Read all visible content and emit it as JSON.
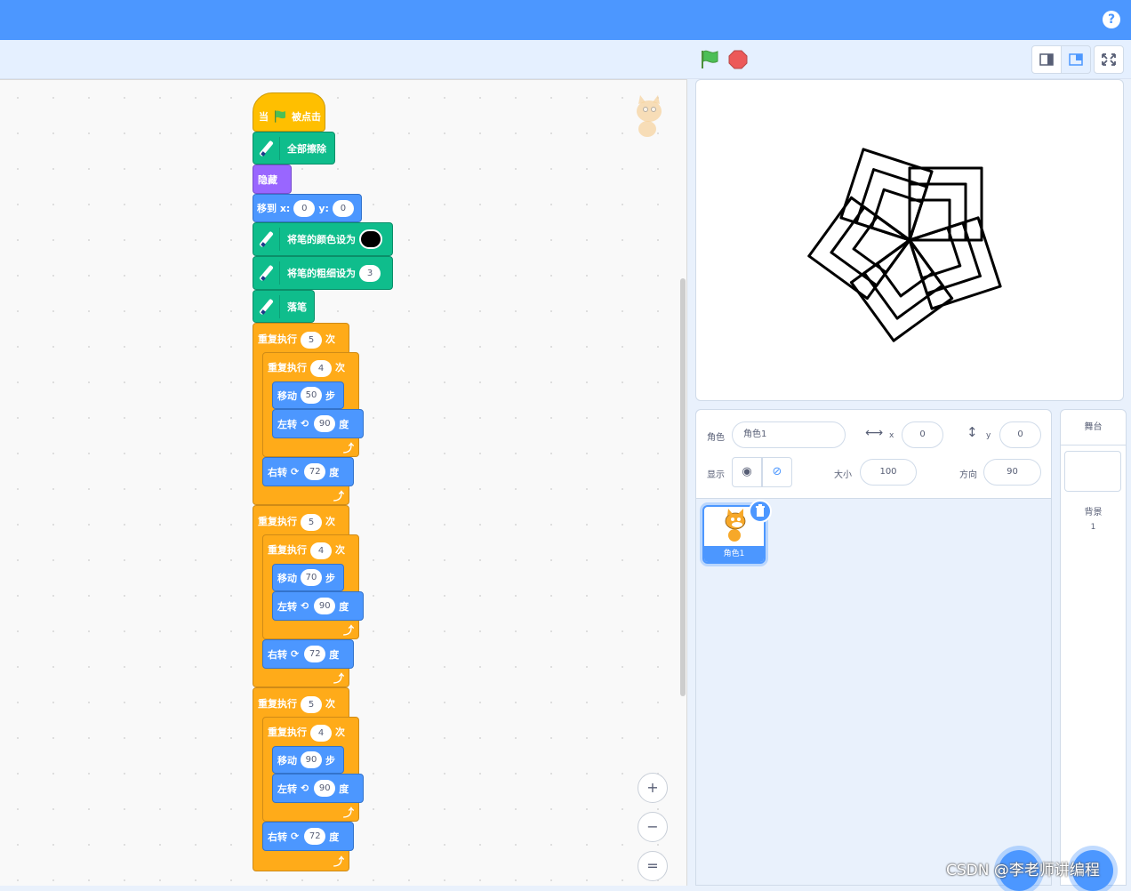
{
  "header": {
    "help_icon": "help-icon",
    "help_label": "?"
  },
  "controls": {
    "flag_icon": "green-flag-icon",
    "stop_icon": "stop-icon"
  },
  "script": {
    "hat": {
      "prefix": "当",
      "suffix": "被点击"
    },
    "clear": "全部擦除",
    "hide": "隐藏",
    "goto": {
      "label": "移到 x:",
      "x": "0",
      "y_label": "y:",
      "y": "0"
    },
    "pen_color": {
      "label": "将笔的颜色设为",
      "color": "#000000"
    },
    "pen_size": {
      "label": "将笔的粗细设为",
      "value": "3"
    },
    "pen_down": "落笔",
    "loops": [
      {
        "repeat_label": "重复执行",
        "times": "5",
        "times_suffix": "次",
        "inner_repeat": "重复执行",
        "inner_times": "4",
        "inner_suffix": "次",
        "move_label": "移动",
        "steps": "50",
        "steps_suffix": "步",
        "turn_left_label": "左转",
        "left_deg": "90",
        "deg_suffix": "度",
        "turn_right_label": "右转",
        "right_deg": "72",
        "right_suffix": "度"
      },
      {
        "repeat_label": "重复执行",
        "times": "5",
        "times_suffix": "次",
        "inner_repeat": "重复执行",
        "inner_times": "4",
        "inner_suffix": "次",
        "move_label": "移动",
        "steps": "70",
        "steps_suffix": "步",
        "turn_left_label": "左转",
        "left_deg": "90",
        "deg_suffix": "度",
        "turn_right_label": "右转",
        "right_deg": "72",
        "right_suffix": "度"
      },
      {
        "repeat_label": "重复执行",
        "times": "5",
        "times_suffix": "次",
        "inner_repeat": "重复执行",
        "inner_times": "4",
        "inner_suffix": "次",
        "move_label": "移动",
        "steps": "90",
        "steps_suffix": "步",
        "turn_left_label": "左转",
        "left_deg": "90",
        "deg_suffix": "度",
        "turn_right_label": "右转",
        "right_deg": "72",
        "right_suffix": "度"
      }
    ]
  },
  "zoom": {
    "in": "+",
    "out": "−",
    "reset": "="
  },
  "sprite_info": {
    "sprite_label": "角色",
    "sprite_name": "角色1",
    "x_label": "x",
    "x": "0",
    "y_label": "y",
    "y": "0",
    "show_label": "显示",
    "size_label": "大小",
    "size": "100",
    "direction_label": "方向",
    "direction": "90"
  },
  "sprite_list": [
    {
      "name": "角色1"
    }
  ],
  "stage_panel": {
    "title": "舞台",
    "backdrop_label": "背景",
    "backdrop_count": "1"
  },
  "watermark": "CSDN @李老师讲编程"
}
